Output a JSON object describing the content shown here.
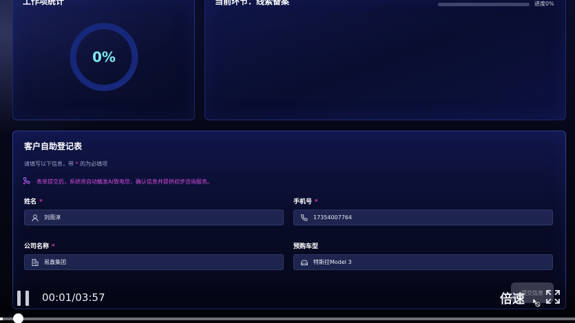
{
  "top_left": {
    "title": "工作项统计",
    "ring_value": "0%",
    "ring_progress": 0
  },
  "top_right": {
    "title": "当前环节：线索备案",
    "progress_label": "进度0%",
    "progress": 0
  },
  "form": {
    "title": "客户自助登记表",
    "subtitle_prefix": "请填写以下信息，带",
    "subtitle_star": "*",
    "subtitle_suffix": "的为必填项",
    "notice": "表单提交后，系统将自动触发AI致电您，确认信息并提供初步咨询服务。",
    "fields": {
      "name": {
        "label": "姓名",
        "required_mark": "*",
        "value": "刘雨淳",
        "icon": "user-icon"
      },
      "phone": {
        "label": "手机号",
        "required_mark": "*",
        "value": "17354007764",
        "icon": "phone-icon"
      },
      "company": {
        "label": "公司名称",
        "required_mark": "*",
        "value": "易鑫集团",
        "icon": "building-icon"
      },
      "car": {
        "label": "预购车型",
        "value": "特斯拉Model 3",
        "icon": "car-icon"
      }
    },
    "submit_label": "提交信息"
  },
  "player": {
    "time": "00:01/03:57",
    "speed_label": "倍速",
    "seek_progress": 0.005
  },
  "colors": {
    "accent": "#e23aa8",
    "ring": "#1a2f7a",
    "ring_text": "#7fe6f0"
  }
}
